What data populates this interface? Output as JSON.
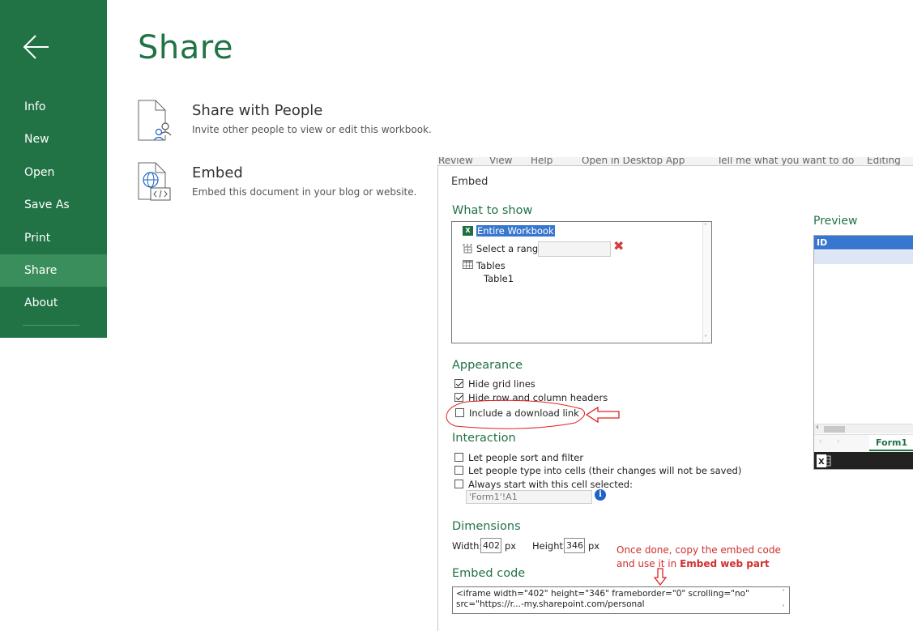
{
  "sidebar": {
    "items": [
      {
        "label": "Info"
      },
      {
        "label": "New"
      },
      {
        "label": "Open"
      },
      {
        "label": "Save As"
      },
      {
        "label": "Print"
      },
      {
        "label": "Share"
      },
      {
        "label": "About"
      }
    ],
    "active": "Share"
  },
  "page": {
    "title": "Share",
    "options": [
      {
        "title": "Share with People",
        "desc": "Invite other people to view or edit this workbook."
      },
      {
        "title": "Embed",
        "desc": "Embed this document in your blog or website."
      }
    ]
  },
  "background_ribbon": [
    "Review",
    "View",
    "Help",
    "Open in Desktop App",
    "Tell me what you want to do",
    "Editing"
  ],
  "embed_dialog": {
    "title": "Embed",
    "what_to_show": {
      "heading": "What to show",
      "entire_workbook": "Entire Workbook",
      "select_range": "Select a range:",
      "tables": "Tables",
      "table1": "Table1"
    },
    "appearance": {
      "heading": "Appearance",
      "hide_grid_lines": "Hide grid lines",
      "hide_headers": "Hide row and column headers",
      "download_link": "Include a download link"
    },
    "interaction": {
      "heading": "Interaction",
      "sort_filter": "Let people sort and filter",
      "type_cells": "Let people type into cells (their changes will not be saved)",
      "start_cell": "Always start with this cell selected:",
      "start_cell_value": "'Form1'!A1"
    },
    "dimensions": {
      "heading": "Dimensions",
      "width_label": "Width:",
      "width_value": "402",
      "height_label": "Height:",
      "height_value": "346",
      "unit": "px"
    },
    "embed_code": {
      "heading": "Embed code",
      "line1": "<iframe width=\"402\" height=\"346\" frameborder=\"0\" scrolling=\"no\"",
      "line2": "src=\"https://r...-my.sharepoint.com/personal"
    },
    "preview": {
      "heading": "Preview",
      "column_header": "ID",
      "sheet_tab": "Form1"
    }
  },
  "annotation": {
    "line1": "Once done, copy the embed code",
    "line2_prefix": "and use it in ",
    "line2_bold": "Embed web part"
  },
  "colors": {
    "sidebar_green": "#217346",
    "active_item": "#3a8e5c",
    "heading_green": "#217346",
    "annotation_red": "#d03030",
    "selection_blue": "#3877cf"
  },
  "icons": [
    "back-arrow-icon",
    "share-people-icon",
    "embed-globe-icon",
    "excel-icon",
    "range-icon",
    "table-icon",
    "clear-x-icon",
    "info-icon"
  ]
}
